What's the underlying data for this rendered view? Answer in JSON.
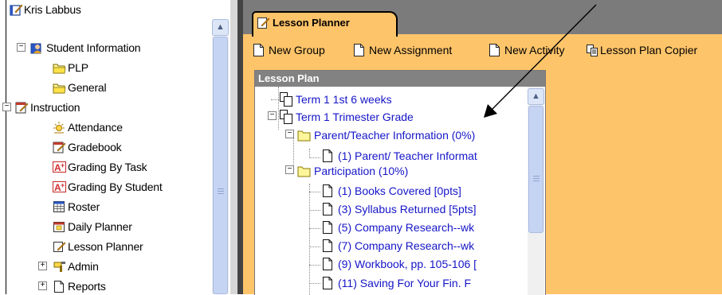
{
  "left_tree": {
    "root_label": "Kris Labbus",
    "student_information": "Student Information",
    "plp": "PLP",
    "general": "General",
    "instruction": "Instruction",
    "attendance": "Attendance",
    "gradebook": "Gradebook",
    "grading_by_task": "Grading By Task",
    "grading_by_student": "Grading By Student",
    "roster": "Roster",
    "daily_planner": "Daily Planner",
    "lesson_planner": "Lesson Planner",
    "admin": "Admin",
    "reports": "Reports",
    "expanded_symbol": "−",
    "collapsed_symbol": "+",
    "scroll_up": "▲"
  },
  "tab": {
    "label": "Lesson Planner"
  },
  "toolbar": {
    "new_group": "New Group",
    "new_assignment": "New Assignment",
    "new_activity": "New Activity",
    "lesson_plan_copier": "Lesson Plan Copier"
  },
  "lesson_plan": {
    "header": "Lesson Plan",
    "term1_6weeks": "Term 1 1st 6 weeks",
    "term1_trimester": "Term 1 Trimester Grade",
    "parent_teacher_info": "Parent/Teacher Information (0%)",
    "parent_teacher_item": "(1) Parent/ Teacher Informat",
    "participation": "Participation (10%)",
    "item_books": "(1) Books Covered [0pts]",
    "item_syllabus": "(3) Syllabus Returned [5pts]",
    "item_company5": "(5) Company Research--wk",
    "item_company7": "(7) Company Research--wk",
    "item_workbook": "(9) Workbook, pp. 105-106 [",
    "item_saving": "(11) Saving For Your Fin. F",
    "scroll_up": "▲"
  },
  "colors": {
    "content_background": "#fec46a",
    "tab_strip": "#7b7b7b",
    "link_blue": "#1515c8",
    "panel_header": "#828282"
  }
}
